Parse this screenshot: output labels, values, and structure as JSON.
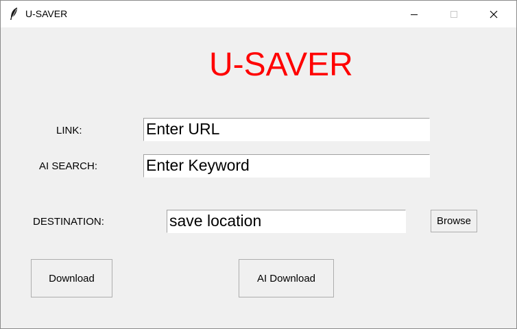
{
  "window": {
    "title": "U-SAVER",
    "app_icon": "feather-icon",
    "controls": [
      "minimize-icon",
      "maximize-icon",
      "close-icon"
    ]
  },
  "app": {
    "heading": "U-SAVER",
    "heading_color": "#ff0000"
  },
  "form": {
    "link_label": "LINK:",
    "link_value": "Enter URL",
    "ai_search_label": "AI SEARCH:",
    "ai_search_value": "Enter Keyword",
    "destination_label": "DESTINATION:",
    "destination_value": "save location",
    "browse_label": "Browse"
  },
  "actions": {
    "download_label": "Download",
    "ai_download_label": "AI Download"
  }
}
